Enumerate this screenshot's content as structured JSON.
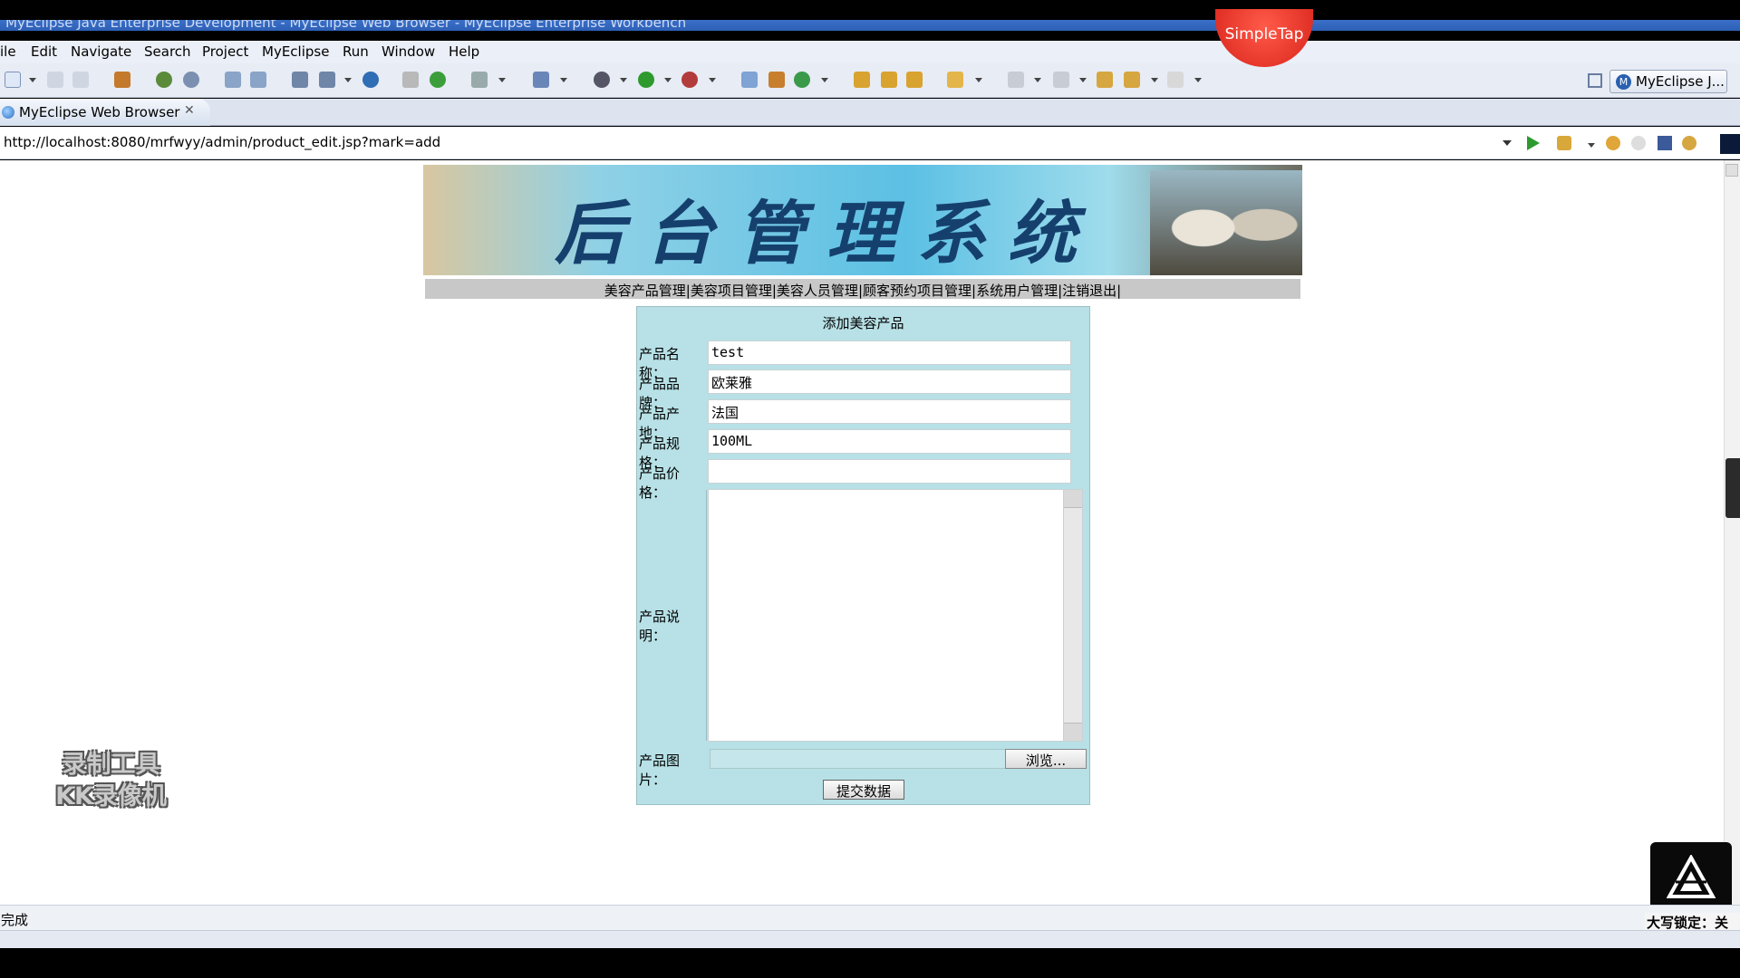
{
  "window": {
    "title": "MyEclipse Java Enterprise Development - MyEclipse Web Browser - MyEclipse Enterprise Workbench"
  },
  "overlay": {
    "simpletap": "SimpleTap"
  },
  "menu": [
    "ile",
    "Edit",
    "Navigate",
    "Search",
    "Project",
    "MyEclipse",
    "Run",
    "Window",
    "Help"
  ],
  "perspective": {
    "label": "MyEclipse J..."
  },
  "tab": {
    "label": "MyEclipse Web Browser"
  },
  "browser": {
    "url": "http://localhost:8080/mrfwyy/admin/product_edit.jsp?mark=add"
  },
  "page": {
    "banner_title": "后台管理系统",
    "nav": [
      "美容产品管理",
      "美容项目管理",
      "美容人员管理",
      "顾客预约项目管理",
      "系统用户管理",
      "注销退出"
    ],
    "form": {
      "title": "添加美容产品",
      "fields": [
        {
          "label": "产品名称：",
          "value": "test"
        },
        {
          "label": "产品品牌：",
          "value": "欧莱雅"
        },
        {
          "label": "产品产地：",
          "value": "法国"
        },
        {
          "label": "产品规格：",
          "value": "100ML"
        },
        {
          "label": "产品价格：",
          "value": ""
        }
      ],
      "description_label": "产品说明：",
      "image_label": "产品图片：",
      "browse_label": "浏览...",
      "submit_label": "提交数据"
    }
  },
  "watermark": {
    "line1": "录制工具",
    "line2": "KK录像机"
  },
  "status": {
    "text": "完成"
  },
  "ime": {
    "text": "大写锁定：关"
  }
}
